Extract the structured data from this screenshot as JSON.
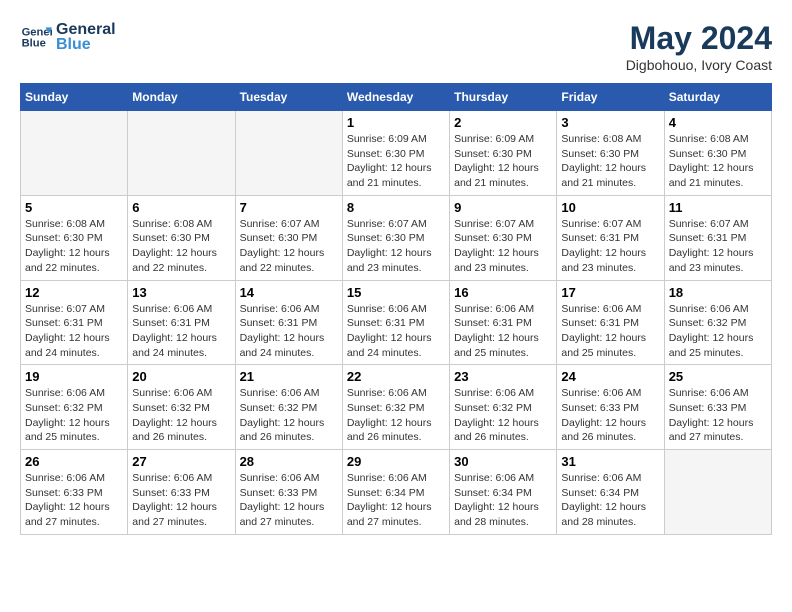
{
  "header": {
    "logo_line1": "General",
    "logo_line2": "Blue",
    "month": "May 2024",
    "location": "Digbohouo, Ivory Coast"
  },
  "weekdays": [
    "Sunday",
    "Monday",
    "Tuesday",
    "Wednesday",
    "Thursday",
    "Friday",
    "Saturday"
  ],
  "weeks": [
    [
      {
        "day": "",
        "info": ""
      },
      {
        "day": "",
        "info": ""
      },
      {
        "day": "",
        "info": ""
      },
      {
        "day": "1",
        "info": "Sunrise: 6:09 AM\nSunset: 6:30 PM\nDaylight: 12 hours\nand 21 minutes."
      },
      {
        "day": "2",
        "info": "Sunrise: 6:09 AM\nSunset: 6:30 PM\nDaylight: 12 hours\nand 21 minutes."
      },
      {
        "day": "3",
        "info": "Sunrise: 6:08 AM\nSunset: 6:30 PM\nDaylight: 12 hours\nand 21 minutes."
      },
      {
        "day": "4",
        "info": "Sunrise: 6:08 AM\nSunset: 6:30 PM\nDaylight: 12 hours\nand 21 minutes."
      }
    ],
    [
      {
        "day": "5",
        "info": "Sunrise: 6:08 AM\nSunset: 6:30 PM\nDaylight: 12 hours\nand 22 minutes."
      },
      {
        "day": "6",
        "info": "Sunrise: 6:08 AM\nSunset: 6:30 PM\nDaylight: 12 hours\nand 22 minutes."
      },
      {
        "day": "7",
        "info": "Sunrise: 6:07 AM\nSunset: 6:30 PM\nDaylight: 12 hours\nand 22 minutes."
      },
      {
        "day": "8",
        "info": "Sunrise: 6:07 AM\nSunset: 6:30 PM\nDaylight: 12 hours\nand 23 minutes."
      },
      {
        "day": "9",
        "info": "Sunrise: 6:07 AM\nSunset: 6:30 PM\nDaylight: 12 hours\nand 23 minutes."
      },
      {
        "day": "10",
        "info": "Sunrise: 6:07 AM\nSunset: 6:31 PM\nDaylight: 12 hours\nand 23 minutes."
      },
      {
        "day": "11",
        "info": "Sunrise: 6:07 AM\nSunset: 6:31 PM\nDaylight: 12 hours\nand 23 minutes."
      }
    ],
    [
      {
        "day": "12",
        "info": "Sunrise: 6:07 AM\nSunset: 6:31 PM\nDaylight: 12 hours\nand 24 minutes."
      },
      {
        "day": "13",
        "info": "Sunrise: 6:06 AM\nSunset: 6:31 PM\nDaylight: 12 hours\nand 24 minutes."
      },
      {
        "day": "14",
        "info": "Sunrise: 6:06 AM\nSunset: 6:31 PM\nDaylight: 12 hours\nand 24 minutes."
      },
      {
        "day": "15",
        "info": "Sunrise: 6:06 AM\nSunset: 6:31 PM\nDaylight: 12 hours\nand 24 minutes."
      },
      {
        "day": "16",
        "info": "Sunrise: 6:06 AM\nSunset: 6:31 PM\nDaylight: 12 hours\nand 25 minutes."
      },
      {
        "day": "17",
        "info": "Sunrise: 6:06 AM\nSunset: 6:31 PM\nDaylight: 12 hours\nand 25 minutes."
      },
      {
        "day": "18",
        "info": "Sunrise: 6:06 AM\nSunset: 6:32 PM\nDaylight: 12 hours\nand 25 minutes."
      }
    ],
    [
      {
        "day": "19",
        "info": "Sunrise: 6:06 AM\nSunset: 6:32 PM\nDaylight: 12 hours\nand 25 minutes."
      },
      {
        "day": "20",
        "info": "Sunrise: 6:06 AM\nSunset: 6:32 PM\nDaylight: 12 hours\nand 26 minutes."
      },
      {
        "day": "21",
        "info": "Sunrise: 6:06 AM\nSunset: 6:32 PM\nDaylight: 12 hours\nand 26 minutes."
      },
      {
        "day": "22",
        "info": "Sunrise: 6:06 AM\nSunset: 6:32 PM\nDaylight: 12 hours\nand 26 minutes."
      },
      {
        "day": "23",
        "info": "Sunrise: 6:06 AM\nSunset: 6:32 PM\nDaylight: 12 hours\nand 26 minutes."
      },
      {
        "day": "24",
        "info": "Sunrise: 6:06 AM\nSunset: 6:33 PM\nDaylight: 12 hours\nand 26 minutes."
      },
      {
        "day": "25",
        "info": "Sunrise: 6:06 AM\nSunset: 6:33 PM\nDaylight: 12 hours\nand 27 minutes."
      }
    ],
    [
      {
        "day": "26",
        "info": "Sunrise: 6:06 AM\nSunset: 6:33 PM\nDaylight: 12 hours\nand 27 minutes."
      },
      {
        "day": "27",
        "info": "Sunrise: 6:06 AM\nSunset: 6:33 PM\nDaylight: 12 hours\nand 27 minutes."
      },
      {
        "day": "28",
        "info": "Sunrise: 6:06 AM\nSunset: 6:33 PM\nDaylight: 12 hours\nand 27 minutes."
      },
      {
        "day": "29",
        "info": "Sunrise: 6:06 AM\nSunset: 6:34 PM\nDaylight: 12 hours\nand 27 minutes."
      },
      {
        "day": "30",
        "info": "Sunrise: 6:06 AM\nSunset: 6:34 PM\nDaylight: 12 hours\nand 28 minutes."
      },
      {
        "day": "31",
        "info": "Sunrise: 6:06 AM\nSunset: 6:34 PM\nDaylight: 12 hours\nand 28 minutes."
      },
      {
        "day": "",
        "info": ""
      }
    ]
  ]
}
